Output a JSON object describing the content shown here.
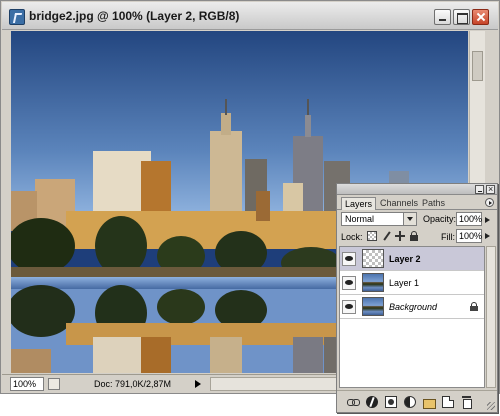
{
  "document": {
    "title": "bridge2.jpg @ 100% (Layer 2, RGB/8)",
    "zoom": "100%",
    "doc_size": "Doc: 791,0K/2,87M"
  },
  "layers_palette": {
    "tabs": [
      {
        "label": "Layers",
        "active": true
      },
      {
        "label": "Channels",
        "active": false
      },
      {
        "label": "Paths",
        "active": false
      }
    ],
    "blend_mode": "Normal",
    "opacity_label": "Opacity:",
    "opacity": "100%",
    "lock_label": "Lock:",
    "fill_label": "Fill:",
    "fill": "100%",
    "layers": [
      {
        "name": "Layer 2",
        "visible": true,
        "selected": true,
        "thumbnail": "transparent"
      },
      {
        "name": "Layer 1",
        "visible": true,
        "selected": false,
        "thumbnail": "photo"
      },
      {
        "name": "Background",
        "visible": true,
        "selected": false,
        "thumbnail": "photo",
        "locked": true
      }
    ],
    "bottom_icons": [
      "link-icon",
      "fx-icon",
      "mask-icon",
      "adjustment-icon",
      "folder-icon",
      "new-layer-icon",
      "trash-icon"
    ]
  },
  "colors": {
    "selected_layer": "#c9c8d8",
    "panel_gray": "#d4d0c8",
    "close_button": "#c6452a"
  }
}
